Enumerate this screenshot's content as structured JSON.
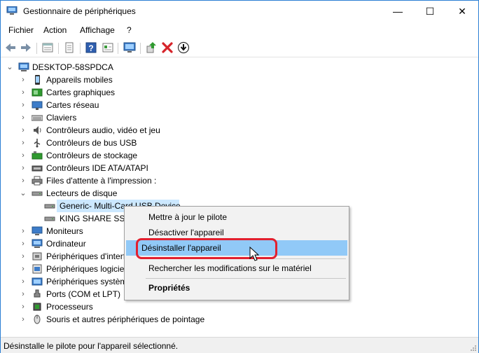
{
  "window": {
    "title": "Gestionnaire de périphériques",
    "minimize_glyph": "—",
    "maximize_glyph": "☐",
    "close_glyph": "✕"
  },
  "menu": [
    "Fichier",
    "Action",
    "Affichage",
    "?"
  ],
  "toolbar_icons": [
    "back-arrow-icon",
    "forward-arrow-icon",
    "properties-grid-icon",
    "driver-icon",
    "help-icon",
    "show-hidden-icon",
    "monitor-scan-icon",
    "update-driver-icon",
    "uninstall-x-icon",
    "download-icon"
  ],
  "tree": {
    "root": "DESKTOP-58SPDCA",
    "categories": [
      {
        "label": "Appareils mobiles",
        "icon": "mobile-device-icon",
        "expanded": false
      },
      {
        "label": "Cartes graphiques",
        "icon": "display-adapter-icon",
        "expanded": false
      },
      {
        "label": "Cartes réseau",
        "icon": "network-adapter-icon",
        "expanded": false
      },
      {
        "label": "Claviers",
        "icon": "keyboard-icon",
        "expanded": false
      },
      {
        "label": "Contrôleurs audio, vidéo et jeu",
        "icon": "audio-icon",
        "expanded": false
      },
      {
        "label": "Contrôleurs de bus USB",
        "icon": "usb-icon",
        "expanded": false
      },
      {
        "label": "Contrôleurs de stockage",
        "icon": "storage-controller-icon",
        "expanded": false
      },
      {
        "label": "Contrôleurs IDE ATA/ATAPI",
        "icon": "ide-controller-icon",
        "expanded": false
      },
      {
        "label": "Files d'attente à l'impression :",
        "icon": "printer-queue-icon",
        "expanded": false
      },
      {
        "label": "Lecteurs de disque",
        "icon": "disk-drive-icon",
        "expanded": true,
        "children": [
          {
            "label": "Generic- Multi-Card USB Device",
            "selected": true
          },
          {
            "label": "KING SHARE SSD",
            "selected": false
          }
        ]
      },
      {
        "label": "Moniteurs",
        "icon": "monitor-icon",
        "expanded": false
      },
      {
        "label": "Ordinateur",
        "icon": "computer-icon",
        "expanded": false
      },
      {
        "label": "Périphériques d'interf",
        "icon": "hid-icon",
        "expanded": false
      },
      {
        "label": "Périphériques logiciel",
        "icon": "software-device-icon",
        "expanded": false
      },
      {
        "label": "Périphériques systèm",
        "icon": "system-device-icon",
        "expanded": false
      },
      {
        "label": "Ports (COM et LPT)",
        "icon": "port-icon",
        "expanded": false
      },
      {
        "label": "Processeurs",
        "icon": "processor-icon",
        "expanded": false
      },
      {
        "label": "Souris et autres périphériques de pointage",
        "icon": "mouse-icon",
        "expanded": false
      }
    ]
  },
  "context_menu": {
    "items": [
      {
        "label": "Mettre à jour le pilote",
        "bold": false,
        "highlighted": false
      },
      {
        "label": "Désactiver l'appareil",
        "bold": false,
        "highlighted": false
      },
      {
        "label": "Désinstaller l'appareil",
        "bold": false,
        "highlighted": true
      },
      {
        "label": "Rechercher les modifications sur le matériel",
        "bold": false,
        "highlighted": false
      },
      {
        "label": "Propriétés",
        "bold": true,
        "highlighted": false
      }
    ]
  },
  "status": "Désinstalle le pilote pour l'appareil sélectionné.",
  "colors": {
    "window_border": "#2b7fd4",
    "selection": "#cce8ff",
    "menu_highlight": "#91c9f7",
    "annotation_red": "#e2202f"
  }
}
